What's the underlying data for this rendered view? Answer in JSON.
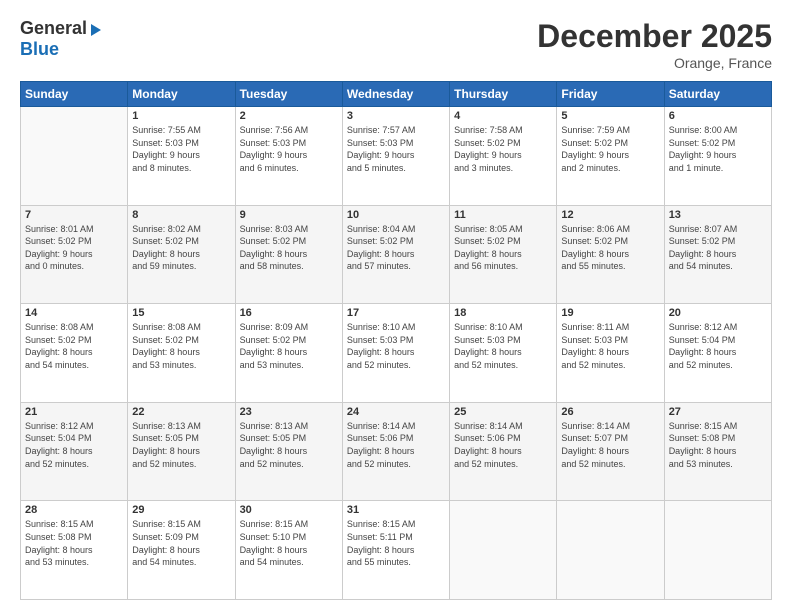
{
  "logo": {
    "general": "General",
    "blue": "Blue"
  },
  "header": {
    "month": "December 2025",
    "location": "Orange, France"
  },
  "weekdays": [
    "Sunday",
    "Monday",
    "Tuesday",
    "Wednesday",
    "Thursday",
    "Friday",
    "Saturday"
  ],
  "weeks": [
    [
      {
        "day": "",
        "info": ""
      },
      {
        "day": "1",
        "info": "Sunrise: 7:55 AM\nSunset: 5:03 PM\nDaylight: 9 hours\nand 8 minutes."
      },
      {
        "day": "2",
        "info": "Sunrise: 7:56 AM\nSunset: 5:03 PM\nDaylight: 9 hours\nand 6 minutes."
      },
      {
        "day": "3",
        "info": "Sunrise: 7:57 AM\nSunset: 5:03 PM\nDaylight: 9 hours\nand 5 minutes."
      },
      {
        "day": "4",
        "info": "Sunrise: 7:58 AM\nSunset: 5:02 PM\nDaylight: 9 hours\nand 3 minutes."
      },
      {
        "day": "5",
        "info": "Sunrise: 7:59 AM\nSunset: 5:02 PM\nDaylight: 9 hours\nand 2 minutes."
      },
      {
        "day": "6",
        "info": "Sunrise: 8:00 AM\nSunset: 5:02 PM\nDaylight: 9 hours\nand 1 minute."
      }
    ],
    [
      {
        "day": "7",
        "info": "Sunrise: 8:01 AM\nSunset: 5:02 PM\nDaylight: 9 hours\nand 0 minutes."
      },
      {
        "day": "8",
        "info": "Sunrise: 8:02 AM\nSunset: 5:02 PM\nDaylight: 8 hours\nand 59 minutes."
      },
      {
        "day": "9",
        "info": "Sunrise: 8:03 AM\nSunset: 5:02 PM\nDaylight: 8 hours\nand 58 minutes."
      },
      {
        "day": "10",
        "info": "Sunrise: 8:04 AM\nSunset: 5:02 PM\nDaylight: 8 hours\nand 57 minutes."
      },
      {
        "day": "11",
        "info": "Sunrise: 8:05 AM\nSunset: 5:02 PM\nDaylight: 8 hours\nand 56 minutes."
      },
      {
        "day": "12",
        "info": "Sunrise: 8:06 AM\nSunset: 5:02 PM\nDaylight: 8 hours\nand 55 minutes."
      },
      {
        "day": "13",
        "info": "Sunrise: 8:07 AM\nSunset: 5:02 PM\nDaylight: 8 hours\nand 54 minutes."
      }
    ],
    [
      {
        "day": "14",
        "info": "Sunrise: 8:08 AM\nSunset: 5:02 PM\nDaylight: 8 hours\nand 54 minutes."
      },
      {
        "day": "15",
        "info": "Sunrise: 8:08 AM\nSunset: 5:02 PM\nDaylight: 8 hours\nand 53 minutes."
      },
      {
        "day": "16",
        "info": "Sunrise: 8:09 AM\nSunset: 5:02 PM\nDaylight: 8 hours\nand 53 minutes."
      },
      {
        "day": "17",
        "info": "Sunrise: 8:10 AM\nSunset: 5:03 PM\nDaylight: 8 hours\nand 52 minutes."
      },
      {
        "day": "18",
        "info": "Sunrise: 8:10 AM\nSunset: 5:03 PM\nDaylight: 8 hours\nand 52 minutes."
      },
      {
        "day": "19",
        "info": "Sunrise: 8:11 AM\nSunset: 5:03 PM\nDaylight: 8 hours\nand 52 minutes."
      },
      {
        "day": "20",
        "info": "Sunrise: 8:12 AM\nSunset: 5:04 PM\nDaylight: 8 hours\nand 52 minutes."
      }
    ],
    [
      {
        "day": "21",
        "info": "Sunrise: 8:12 AM\nSunset: 5:04 PM\nDaylight: 8 hours\nand 52 minutes."
      },
      {
        "day": "22",
        "info": "Sunrise: 8:13 AM\nSunset: 5:05 PM\nDaylight: 8 hours\nand 52 minutes."
      },
      {
        "day": "23",
        "info": "Sunrise: 8:13 AM\nSunset: 5:05 PM\nDaylight: 8 hours\nand 52 minutes."
      },
      {
        "day": "24",
        "info": "Sunrise: 8:14 AM\nSunset: 5:06 PM\nDaylight: 8 hours\nand 52 minutes."
      },
      {
        "day": "25",
        "info": "Sunrise: 8:14 AM\nSunset: 5:06 PM\nDaylight: 8 hours\nand 52 minutes."
      },
      {
        "day": "26",
        "info": "Sunrise: 8:14 AM\nSunset: 5:07 PM\nDaylight: 8 hours\nand 52 minutes."
      },
      {
        "day": "27",
        "info": "Sunrise: 8:15 AM\nSunset: 5:08 PM\nDaylight: 8 hours\nand 53 minutes."
      }
    ],
    [
      {
        "day": "28",
        "info": "Sunrise: 8:15 AM\nSunset: 5:08 PM\nDaylight: 8 hours\nand 53 minutes."
      },
      {
        "day": "29",
        "info": "Sunrise: 8:15 AM\nSunset: 5:09 PM\nDaylight: 8 hours\nand 54 minutes."
      },
      {
        "day": "30",
        "info": "Sunrise: 8:15 AM\nSunset: 5:10 PM\nDaylight: 8 hours\nand 54 minutes."
      },
      {
        "day": "31",
        "info": "Sunrise: 8:15 AM\nSunset: 5:11 PM\nDaylight: 8 hours\nand 55 minutes."
      },
      {
        "day": "",
        "info": ""
      },
      {
        "day": "",
        "info": ""
      },
      {
        "day": "",
        "info": ""
      }
    ]
  ]
}
